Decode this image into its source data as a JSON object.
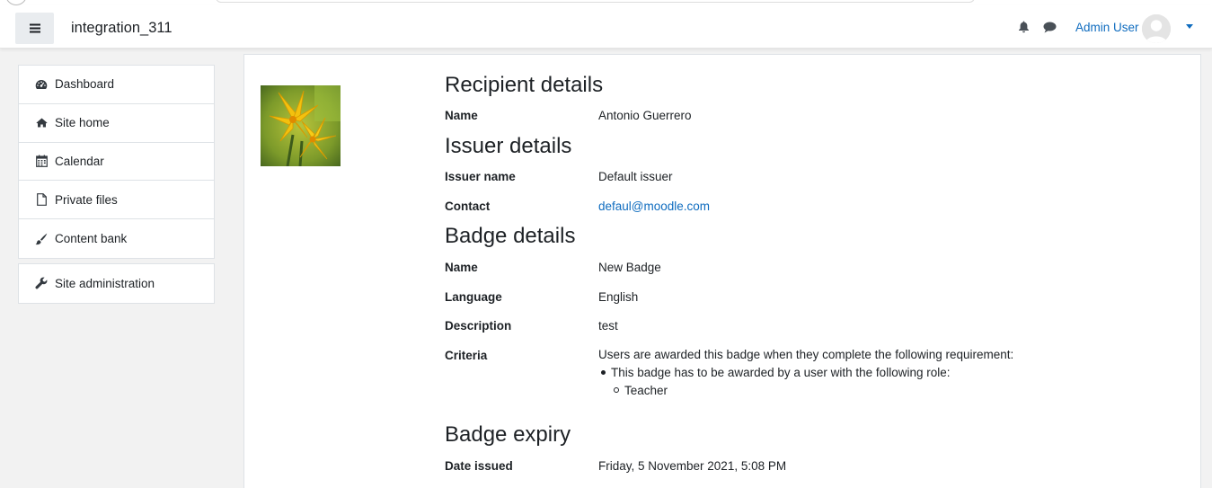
{
  "navbar": {
    "site_name": "integration_311",
    "user_name": "Admin User",
    "icons": [
      "menu-icon",
      "bell-icon",
      "chat-icon",
      "avatar",
      "caret-down-icon"
    ]
  },
  "sidebar": {
    "group1": [
      {
        "label": "Dashboard",
        "icon": "dashboard-icon"
      },
      {
        "label": "Site home",
        "icon": "home-icon"
      },
      {
        "label": "Calendar",
        "icon": "calendar-icon"
      },
      {
        "label": "Private files",
        "icon": "file-icon"
      },
      {
        "label": "Content bank",
        "icon": "brush-icon"
      }
    ],
    "group2": [
      {
        "label": "Site administration",
        "icon": "wrench-icon"
      }
    ]
  },
  "recipient": {
    "heading": "Recipient details",
    "name_label": "Name",
    "name_value": "Antonio Guerrero"
  },
  "issuer": {
    "heading": "Issuer details",
    "issuer_name_label": "Issuer name",
    "issuer_name_value": "Default issuer",
    "contact_label": "Contact",
    "contact_value": "defaul@moodle.com"
  },
  "badge": {
    "heading": "Badge details",
    "name_label": "Name",
    "name_value": "New Badge",
    "language_label": "Language",
    "language_value": "English",
    "description_label": "Description",
    "description_value": "test",
    "criteria_label": "Criteria",
    "criteria_intro": "Users are awarded this badge when they complete the following requirement:",
    "criteria_item": "This badge has to be awarded by a user with the following role:",
    "criteria_subitem": "Teacher"
  },
  "expiry": {
    "heading": "Badge expiry",
    "date_issued_label": "Date issued",
    "date_issued_value": "Friday, 5 November 2021, 5:08 PM"
  },
  "colors": {
    "link": "#0f6cbf",
    "text": "#1d2125",
    "page_bg": "#f2f2f2"
  }
}
